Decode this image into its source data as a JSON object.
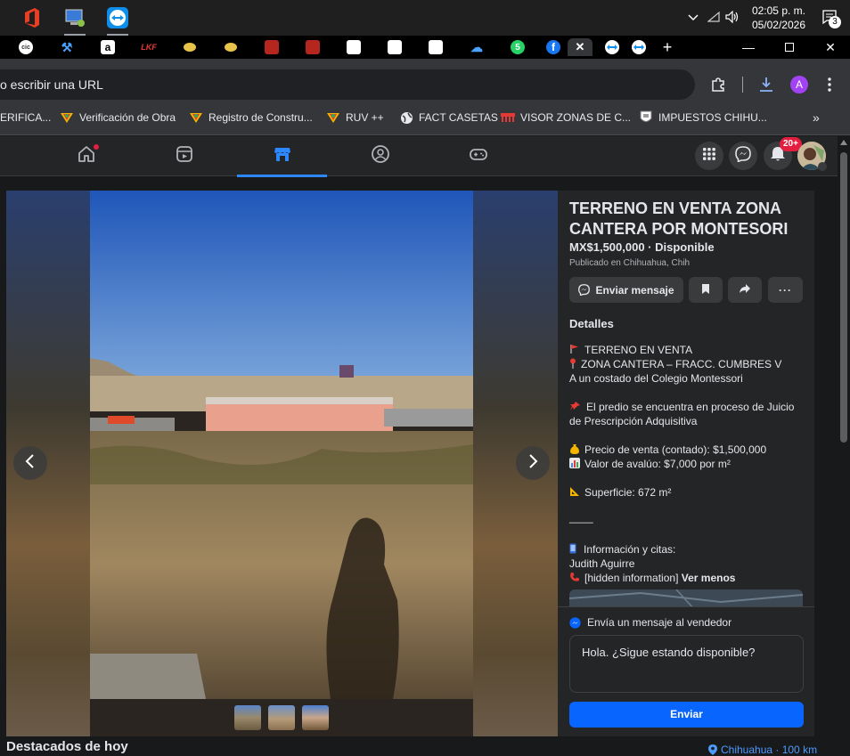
{
  "taskbar": {
    "clock_time": "02:05 p. m.",
    "clock_date": "05/02/2026",
    "notification_count": "3"
  },
  "browser": {
    "omnibox_text": "o escribir una URL",
    "profile_initial": "A",
    "bookmarks": [
      {
        "label": "ERIFICA...",
        "icon": "document-icon"
      },
      {
        "label": "Verificación de Obra",
        "icon": "ruv-icon"
      },
      {
        "label": "Registro de Constru...",
        "icon": "ruv-icon"
      },
      {
        "label": "RUV ++",
        "icon": "ruv-icon"
      },
      {
        "label": "FACT CASETAS",
        "icon": "globe-icon"
      },
      {
        "label": "VISOR ZONAS DE C...",
        "icon": "bridge-icon"
      },
      {
        "label": "IMPUESTOS CHIHU...",
        "icon": "shield-icon"
      }
    ]
  },
  "fb": {
    "notification_badge": "20+"
  },
  "listing": {
    "title": "TERRENO EN VENTA ZONA CANTERA POR MONTESORI",
    "price_line": "MX$1,500,000 · Disponible",
    "published": "Publicado en Chihuahua, Chih",
    "send_message_label": "Enviar mensaje",
    "details_heading": "Detalles",
    "desc_lines": [
      "TERRENO EN VENTA",
      "ZONA CANTERA – FRACC. CUMBRES V",
      "A un costado del Colegio Montessori",
      "El predio se encuentra en proceso de Juicio",
      "de Prescripción Adquisitiva",
      "Precio de venta (contado): $1,500,000",
      "Valor de avalúo: $7,000 por m²",
      "Superficie: 672 m²",
      "____",
      "Información y citas:",
      "Judith Aguirre",
      "[hidden information]",
      "Ver menos"
    ],
    "seller_prompt": "Envía un mensaje al vendedor",
    "message_text": "Hola. ¿Sigue estando disponible?",
    "send_label": "Enviar"
  },
  "footer": {
    "featured_heading": "Destacados de hoy",
    "location": "Chihuahua · 100 km"
  },
  "colors": {
    "accent": "#0866ff",
    "nav_selected": "#2d88ff",
    "badge": "#e41e3f"
  }
}
